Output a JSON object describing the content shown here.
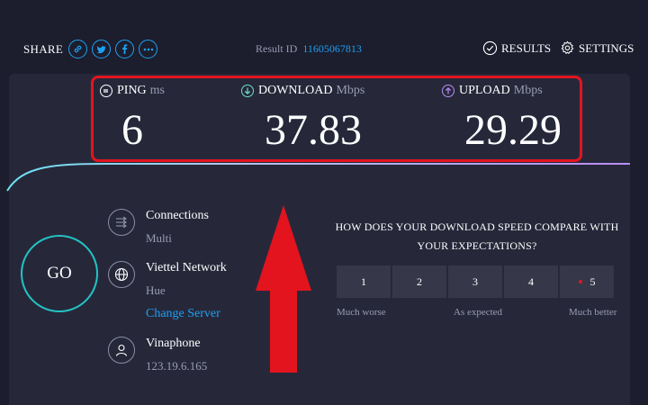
{
  "header": {
    "share_label": "SHARE",
    "share_icons": [
      "link-icon",
      "twitter-icon",
      "facebook-icon",
      "more-icon"
    ],
    "result_id_label": "Result ID",
    "result_id": "11605067813",
    "results_label": "RESULTS",
    "settings_label": "SETTINGS"
  },
  "metrics": {
    "ping": {
      "label": "PING",
      "unit": "ms",
      "value": "6",
      "color": "#ffffff"
    },
    "download": {
      "label": "DOWNLOAD",
      "unit": "Mbps",
      "value": "37.83",
      "color": "#6de1c4"
    },
    "upload": {
      "label": "UPLOAD",
      "unit": "Mbps",
      "value": "29.29",
      "color": "#b98cf2"
    }
  },
  "go_label": "GO",
  "server": {
    "connections_title": "Connections",
    "connections_value": "Multi",
    "network_title": "Viettel Network",
    "network_location": "Hue",
    "change_server": "Change Server",
    "isp_title": "Vinaphone",
    "isp_ip": "123.19.6.165"
  },
  "survey": {
    "question": "HOW DOES YOUR DOWNLOAD SPEED COMPARE WITH YOUR EXPECTATIONS?",
    "options": [
      "1",
      "2",
      "3",
      "4",
      "5"
    ],
    "label_low": "Much worse",
    "label_mid": "As expected",
    "label_high": "Much better"
  },
  "colors": {
    "accent": "#1da1f2",
    "highlight_border": "#e3141e",
    "go_ring": "#23c4c4",
    "background": "#1c1d2d",
    "panel": "#26283a"
  }
}
